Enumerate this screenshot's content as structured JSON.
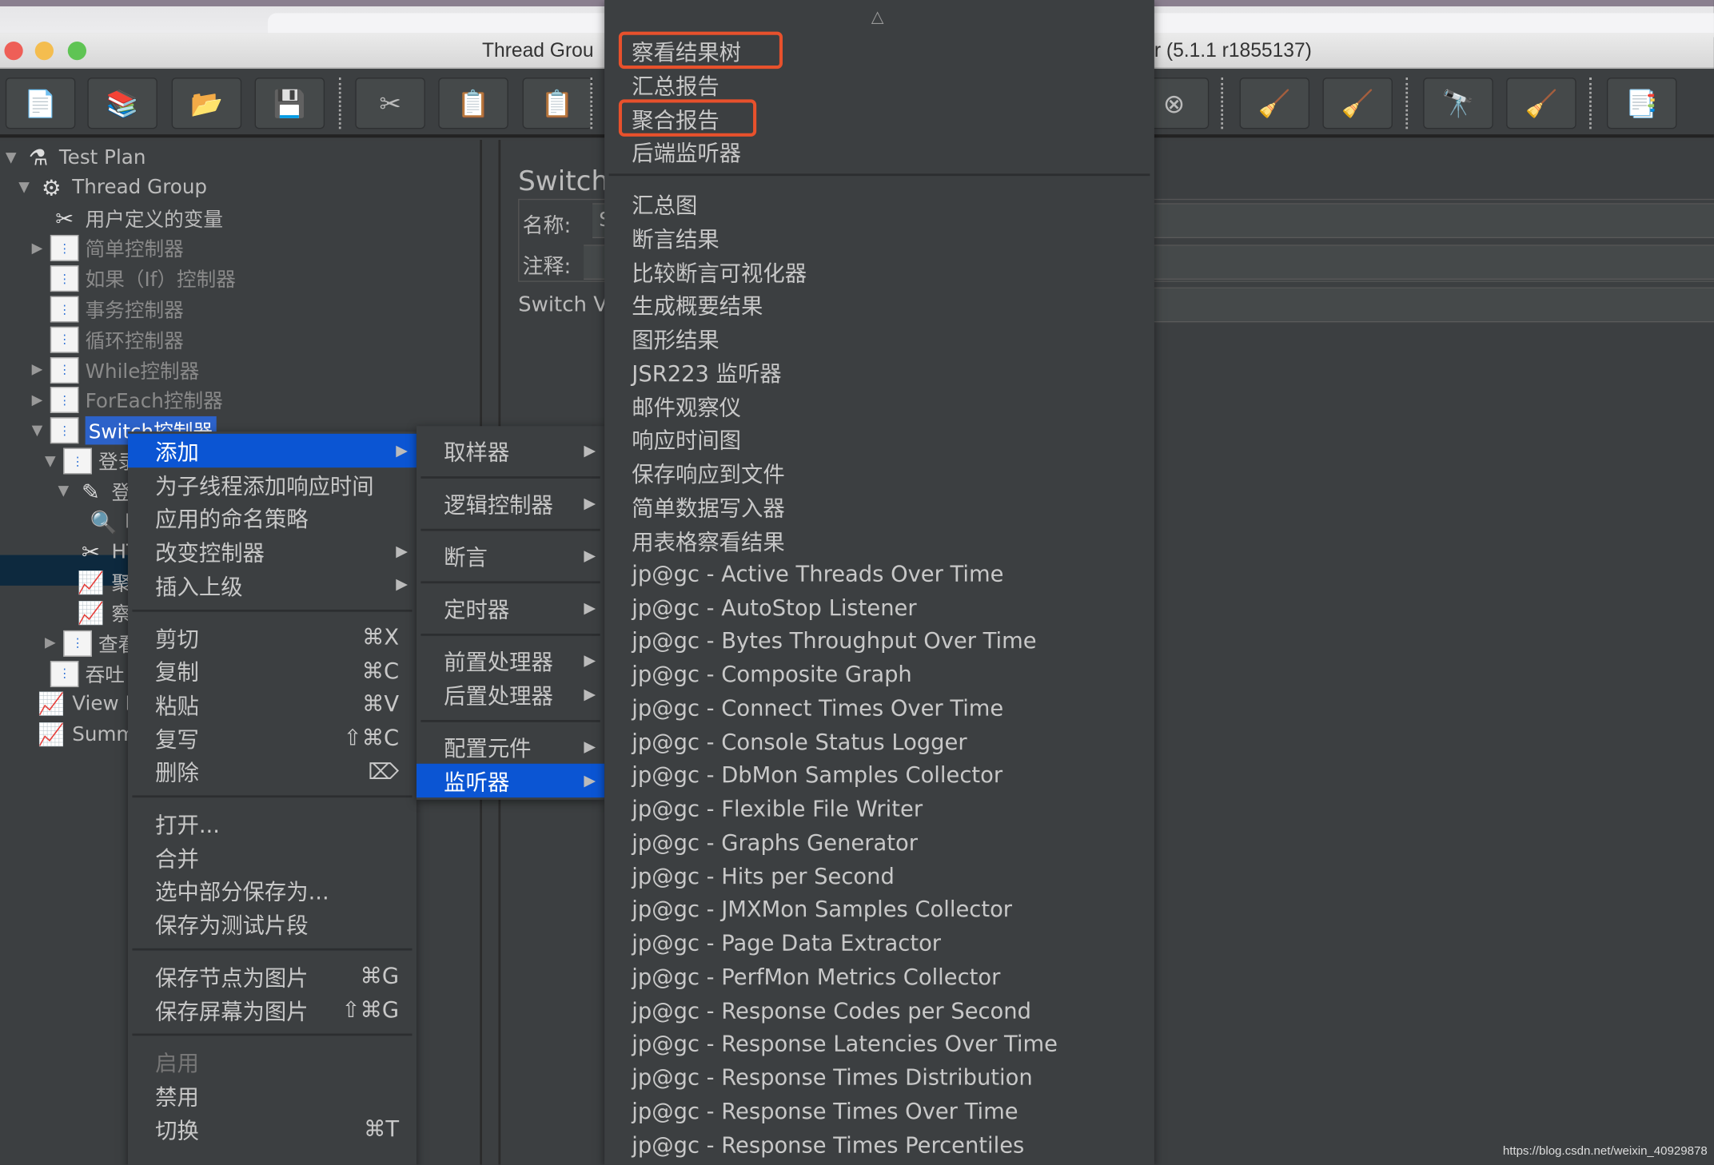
{
  "window": {
    "title_left": "Thread Grou",
    "title_right": "r (5.1.1 r1855137)",
    "traffic_lights": [
      "#ee5f57",
      "#f4bd4f",
      "#5fc454"
    ]
  },
  "toolbar": {
    "icons": [
      "new-icon",
      "templates-icon",
      "open-icon",
      "save-icon",
      "cut-icon",
      "copy-icon",
      "paste-icon",
      "stop-icon",
      "clear-icon",
      "clear-all-icon",
      "search-icon",
      "reset-search-icon",
      "function-helper-icon"
    ]
  },
  "tree": [
    {
      "label": "Test Plan",
      "icon": "flask-icon",
      "arrow": "▼",
      "level": 0
    },
    {
      "label": "Thread Group",
      "icon": "gear-icon",
      "arrow": "▼",
      "level": 1
    },
    {
      "label": "用户定义的变量",
      "icon": "tools-icon",
      "arrow": "",
      "level": 2
    },
    {
      "label": "简单控制器",
      "icon": "controller-icon",
      "arrow": "▶",
      "level": 2,
      "disabled": true
    },
    {
      "label": "如果（If）控制器",
      "icon": "controller-icon",
      "arrow": "",
      "level": 2,
      "disabled": true
    },
    {
      "label": "事务控制器",
      "icon": "controller-icon",
      "arrow": "",
      "level": 2,
      "disabled": true
    },
    {
      "label": "循环控制器",
      "icon": "controller-icon",
      "arrow": "",
      "level": 2,
      "disabled": true
    },
    {
      "label": "While控制器",
      "icon": "controller-icon",
      "arrow": "▶",
      "level": 2,
      "disabled": true
    },
    {
      "label": "ForEach控制器",
      "icon": "controller-icon",
      "arrow": "▶",
      "level": 2,
      "disabled": true
    },
    {
      "label": "Switch控制器",
      "icon": "controller-icon",
      "arrow": "▼",
      "level": 2,
      "selected": true
    },
    {
      "label": "登录",
      "icon": "controller-icon",
      "arrow": "▼",
      "level": 3
    },
    {
      "label": "登",
      "icon": "sampler-icon",
      "arrow": "▼",
      "level": 4
    },
    {
      "label": "I",
      "icon": "magnifier-icon",
      "arrow": "",
      "level": 5
    },
    {
      "label": "HT",
      "icon": "tools-icon",
      "arrow": "",
      "level": 4
    },
    {
      "label": "聚",
      "icon": "listener-icon",
      "arrow": "",
      "level": 4
    },
    {
      "label": "察",
      "icon": "listener-icon",
      "arrow": "",
      "level": 4
    },
    {
      "label": "查看",
      "icon": "controller-icon",
      "arrow": "▶",
      "level": 3
    },
    {
      "label": "吞吐",
      "icon": "controller-icon",
      "arrow": "",
      "level": 2
    },
    {
      "label": "View R",
      "icon": "listener-icon",
      "arrow": "",
      "level": 1
    },
    {
      "label": "Summ",
      "icon": "listener-icon",
      "arrow": "",
      "level": 1
    }
  ],
  "right_panel": {
    "title": "Switch控",
    "name_label": "名称:",
    "name_value": "S",
    "comment_label": "注释:",
    "switch_value_label": "Switch Va"
  },
  "context_menu": {
    "groups": [
      [
        {
          "label": "添加",
          "submenu": true,
          "highlighted": true
        },
        {
          "label": "为子线程添加响应时间"
        },
        {
          "label": "应用的命名策略"
        },
        {
          "label": "改变控制器",
          "submenu": true
        },
        {
          "label": "插入上级",
          "submenu": true
        }
      ],
      [
        {
          "label": "剪切",
          "shortcut": "⌘X"
        },
        {
          "label": "复制",
          "shortcut": "⌘C"
        },
        {
          "label": "粘贴",
          "shortcut": "⌘V"
        },
        {
          "label": "复写",
          "shortcut": "⇧⌘C"
        },
        {
          "label": "删除",
          "shortcut": "⌦"
        }
      ],
      [
        {
          "label": "打开..."
        },
        {
          "label": "合并"
        },
        {
          "label": "选中部分保存为..."
        },
        {
          "label": "保存为测试片段"
        }
      ],
      [
        {
          "label": "保存节点为图片",
          "shortcut": "⌘G"
        },
        {
          "label": "保存屏幕为图片",
          "shortcut": "⇧⌘G"
        }
      ],
      [
        {
          "label": "启用",
          "disabled": true
        },
        {
          "label": "禁用"
        },
        {
          "label": "切换",
          "shortcut": "⌘T"
        }
      ]
    ]
  },
  "add_submenu": [
    {
      "label": "取样器"
    },
    {
      "label": "逻辑控制器"
    },
    {
      "label": "断言"
    },
    {
      "label": "定时器"
    },
    {
      "label": "前置处理器"
    },
    {
      "label": "后置处理器"
    },
    {
      "label": "配置元件"
    },
    {
      "label": "监听器",
      "highlighted": true
    }
  ],
  "listener_menu": {
    "scroll_up": "△",
    "top": [
      {
        "label": "察看结果树",
        "marked": true
      },
      {
        "label": "汇总报告"
      },
      {
        "label": "聚合报告",
        "marked": true
      },
      {
        "label": "后端监听器"
      }
    ],
    "items": [
      "汇总图",
      "断言结果",
      "比较断言可视化器",
      "生成概要结果",
      "图形结果",
      "JSR223 监听器",
      "邮件观察仪",
      "响应时间图",
      "保存响应到文件",
      "简单数据写入器",
      "用表格察看结果",
      "jp@gc - Active Threads Over Time",
      "jp@gc - AutoStop Listener",
      "jp@gc - Bytes Throughput Over Time",
      "jp@gc - Composite Graph",
      "jp@gc - Connect Times Over Time",
      "jp@gc - Console Status Logger",
      "jp@gc - DbMon Samples Collector",
      "jp@gc - Flexible File Writer",
      "jp@gc - Graphs Generator",
      "jp@gc - Hits per Second",
      "jp@gc - JMXMon Samples Collector",
      "jp@gc - Page Data Extractor",
      "jp@gc - PerfMon Metrics Collector",
      "jp@gc - Response Codes per Second",
      "jp@gc - Response Latencies Over Time",
      "jp@gc - Response Times Distribution",
      "jp@gc - Response Times Over Time",
      "jp@gc - Response Times Percentiles"
    ],
    "highlight_color": "#e8512c"
  },
  "watermark": "https://blog.csdn.net/weixin_40929878"
}
